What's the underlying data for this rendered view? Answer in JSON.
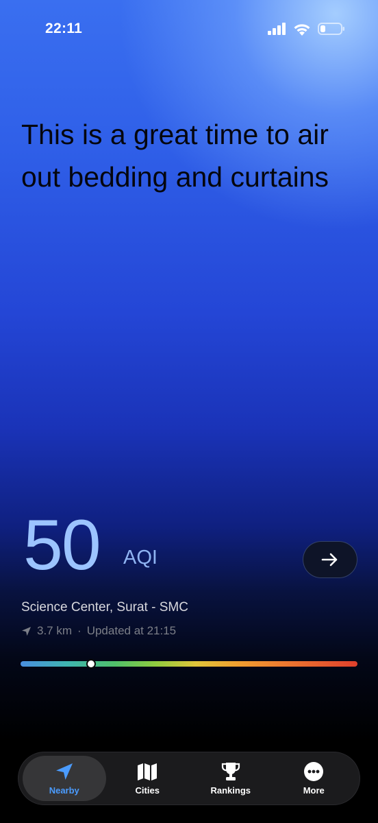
{
  "status_bar": {
    "time": "22:11"
  },
  "headline": "This is a great time to air out bedding and curtains",
  "aqi": {
    "value": "50",
    "unit": "AQI",
    "scale_position": 0.205
  },
  "station": {
    "name": "Science Center, Surat - SMC",
    "distance": "3.7 km",
    "separator": "·",
    "updated": "Updated at 21:15"
  },
  "colors": {
    "accent": "#4b9cff",
    "aqi_text": "#9cc4ff"
  },
  "tabs": [
    {
      "label": "Nearby",
      "icon": "location-arrow-icon",
      "active": true
    },
    {
      "label": "Cities",
      "icon": "map-icon",
      "active": false
    },
    {
      "label": "Rankings",
      "icon": "trophy-icon",
      "active": false
    },
    {
      "label": "More",
      "icon": "more-icon",
      "active": false
    }
  ]
}
